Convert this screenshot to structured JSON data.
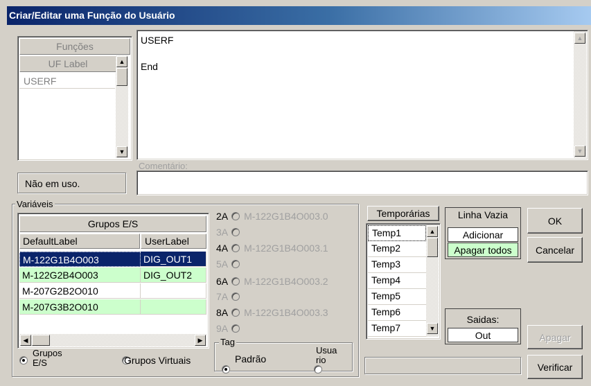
{
  "window": {
    "title": "Criar/Editar uma Função do Usuário"
  },
  "functions_panel": {
    "header": "Funções",
    "subheader": "UF Label",
    "items": [
      "USERF"
    ]
  },
  "editor": {
    "lines": [
      "USERF",
      "",
      "End"
    ]
  },
  "comment": {
    "label": "Comentário:",
    "value": ""
  },
  "usage_status": "Não em uso.",
  "variables": {
    "group_label": "Variáveis",
    "io_groups": {
      "title": "Grupos E/S",
      "columns": [
        "DefaultLabel",
        "UserLabel"
      ],
      "rows": [
        {
          "default": "M-122G1B4O003",
          "user": "DIG_OUT1"
        },
        {
          "default": "M-122G2B4O003",
          "user": "DIG_OUT2"
        },
        {
          "default": "M-207G2B2O010",
          "user": ""
        },
        {
          "default": "M-207G3B2O010",
          "user": ""
        }
      ]
    },
    "group_type": {
      "io": "Grupos E/S",
      "virtual": "Grupos Virtuais",
      "selected": "io"
    },
    "addresses": [
      {
        "label": "2A",
        "value": "M-122G1B4O003.0"
      },
      {
        "label": "3A",
        "value": ""
      },
      {
        "label": "4A",
        "value": "M-122G1B4O003.1"
      },
      {
        "label": "5A",
        "value": ""
      },
      {
        "label": "6A",
        "value": "M-122G1B4O003.2"
      },
      {
        "label": "7A",
        "value": ""
      },
      {
        "label": "8A",
        "value": "M-122G1B4O003.3"
      },
      {
        "label": "9A",
        "value": ""
      }
    ],
    "tag": {
      "label": "Tag",
      "standard": "Padrão",
      "user": "Usuário",
      "user_visible": "Usua rio",
      "selected": "standard"
    }
  },
  "temporaries": {
    "title": "Temporárias",
    "items": [
      "Temp1",
      "Temp2",
      "Temp3",
      "Temp4",
      "Temp5",
      "Temp6",
      "Temp7"
    ]
  },
  "empty_line": {
    "title": "Linha Vazia",
    "add": "Adicionar",
    "delete_all": "Apagar todos"
  },
  "outputs": {
    "title": "Saidas:",
    "value": "Out"
  },
  "buttons": {
    "ok": "OK",
    "cancel": "Cancelar",
    "delete": "Apagar",
    "verify": "Verificar"
  },
  "colors": {
    "title_bar": "#0a246a",
    "selected_row": "#0a246a",
    "assigned_row": "#ccffcc",
    "window_bg": "#d4d0c8"
  }
}
